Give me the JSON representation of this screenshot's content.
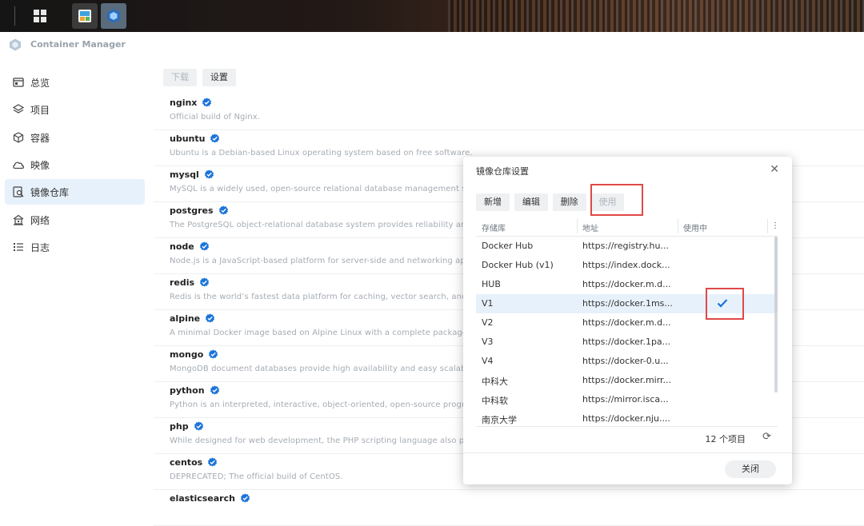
{
  "app": {
    "title": "Container Manager"
  },
  "sidebar": {
    "items": [
      {
        "label": "总览",
        "icon": "overview-icon"
      },
      {
        "label": "项目",
        "icon": "layers-icon"
      },
      {
        "label": "容器",
        "icon": "cube-icon"
      },
      {
        "label": "映像",
        "icon": "cloud-icon"
      },
      {
        "label": "镜像仓库",
        "icon": "registry-search-icon",
        "active": true
      },
      {
        "label": "网络",
        "icon": "network-icon"
      },
      {
        "label": "日志",
        "icon": "list-icon"
      }
    ]
  },
  "toolbar": {
    "download_label": "下载",
    "settings_label": "设置"
  },
  "images": [
    {
      "name": "nginx",
      "desc": "Official build of Nginx."
    },
    {
      "name": "ubuntu",
      "desc": "Ubuntu is a Debian-based Linux operating system based on free software."
    },
    {
      "name": "mysql",
      "desc": "MySQL is a widely used, open-source relational database management system (RDBMS)."
    },
    {
      "name": "postgres",
      "desc": "The PostgreSQL object-relational database system provides reliability and data integrity."
    },
    {
      "name": "node",
      "desc": "Node.js is a JavaScript-based platform for server-side and networking applications."
    },
    {
      "name": "redis",
      "desc": "Redis is the world’s fastest data platform for caching, vector search, and NoSQL databases."
    },
    {
      "name": "alpine",
      "desc": "A minimal Docker image based on Alpine Linux with a complete package index and only 5 MB in size!"
    },
    {
      "name": "mongo",
      "desc": "MongoDB document databases provide high availability and easy scalability."
    },
    {
      "name": "python",
      "desc": "Python is an interpreted, interactive, object-oriented, open-source programming language."
    },
    {
      "name": "php",
      "desc": "While designed for web development, the PHP scripting language also provides general-purpose use."
    },
    {
      "name": "centos",
      "desc": "DEPRECATED; The official build of CentOS."
    },
    {
      "name": "elasticsearch",
      "desc": ""
    }
  ],
  "dialog": {
    "title": "镜像仓库设置",
    "buttons": {
      "add": "新增",
      "edit": "编辑",
      "delete": "删除",
      "use": "使用"
    },
    "columns": {
      "registry": "存储库",
      "address": "地址",
      "in_use": "使用中"
    },
    "rows": [
      {
        "name": "Docker Hub",
        "url": "https://registry.hu...",
        "in_use": false
      },
      {
        "name": "Docker Hub (v1)",
        "url": "https://index.dock...",
        "in_use": false
      },
      {
        "name": "HUB",
        "url": "https://docker.m.d...",
        "in_use": false
      },
      {
        "name": "V1",
        "url": "https://docker.1ms...",
        "in_use": true
      },
      {
        "name": "V2",
        "url": "https://docker.m.d...",
        "in_use": false
      },
      {
        "name": "V3",
        "url": "https://docker.1pa...",
        "in_use": false
      },
      {
        "name": "V4",
        "url": "https://docker-0.u...",
        "in_use": false
      },
      {
        "name": "中科大",
        "url": "https://docker.mirr...",
        "in_use": false
      },
      {
        "name": "中科软",
        "url": "https://mirror.isca...",
        "in_use": false
      },
      {
        "name": "南京大学",
        "url": "https://docker.nju....",
        "in_use": false
      }
    ],
    "count": "12 个项目",
    "close_label": "关闭"
  },
  "colors": {
    "accent": "#1a73d9",
    "highlight": "#e04848",
    "selected_row": "#e7f1fb"
  }
}
